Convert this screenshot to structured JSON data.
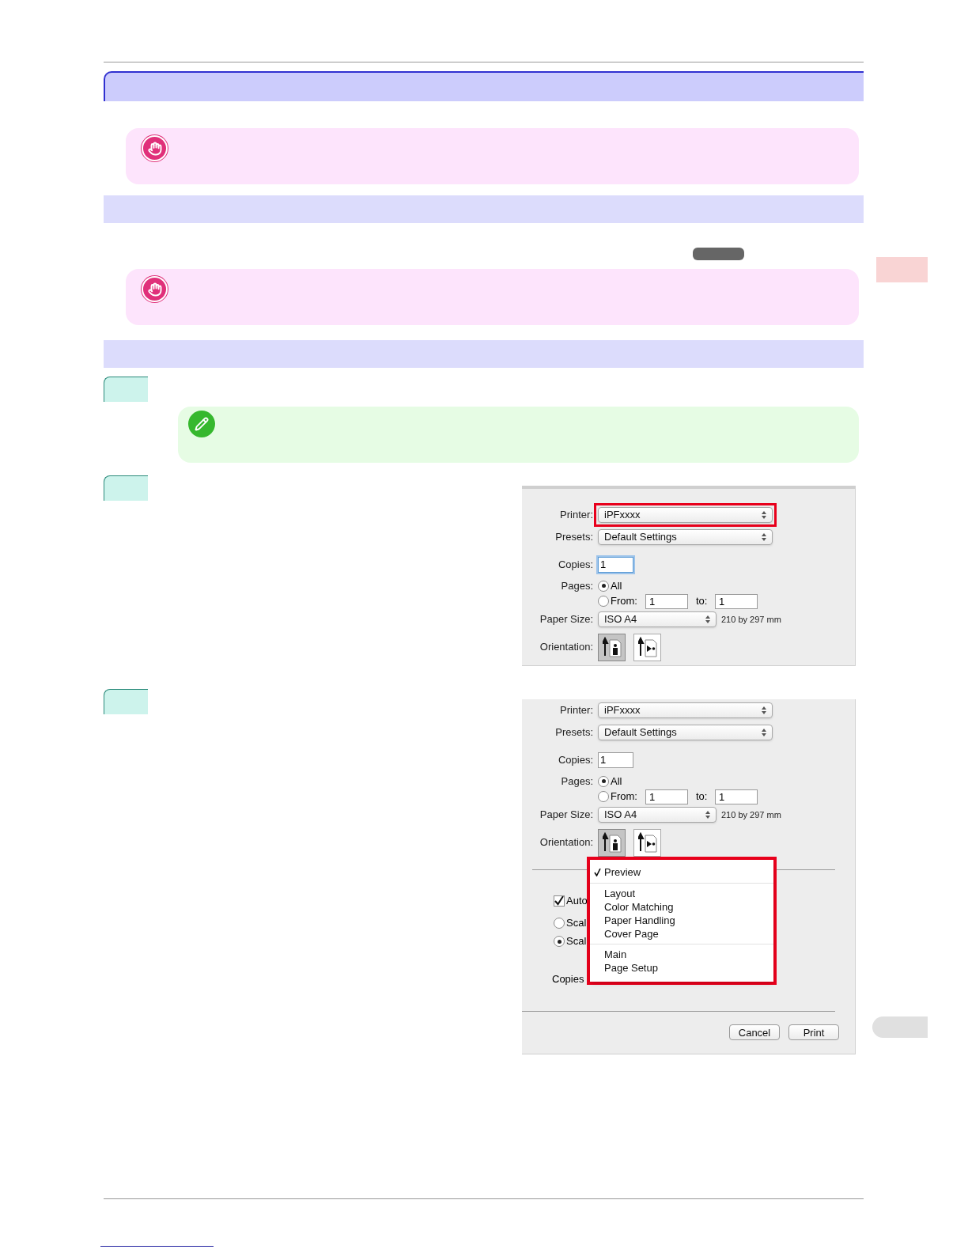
{
  "dialogs": [
    {
      "highlight_printer": true,
      "printer": {
        "label": "Printer:",
        "value": "iPFxxxx"
      },
      "presets": {
        "label": "Presets:",
        "value": "Default Settings"
      },
      "copies": {
        "label": "Copies:",
        "value": "1",
        "focused": true
      },
      "pages": {
        "label": "Pages:",
        "options": [
          {
            "label": "All",
            "selected": true
          },
          {
            "label": "From:",
            "selected": false
          }
        ],
        "from": "1",
        "to_label": "to:",
        "to": "1"
      },
      "paper_size": {
        "label": "Paper Size:",
        "value": "ISO A4",
        "dimensions": "210 by 297 mm"
      },
      "orientation": {
        "label": "Orientation:",
        "options": [
          {
            "kind": "portrait",
            "selected": true
          },
          {
            "kind": "landscape",
            "selected": false
          }
        ]
      }
    },
    {
      "highlight_printer": false,
      "printer": {
        "label": "Printer:",
        "value": "iPFxxxx"
      },
      "presets": {
        "label": "Presets:",
        "value": "Default Settings"
      },
      "copies": {
        "label": "Copies:",
        "value": "1",
        "focused": false
      },
      "pages": {
        "label": "Pages:",
        "options": [
          {
            "label": "All",
            "selected": true
          },
          {
            "label": "From:",
            "selected": false
          }
        ],
        "from": "1",
        "to_label": "to:",
        "to": "1"
      },
      "paper_size": {
        "label": "Paper Size:",
        "value": "ISO A4",
        "dimensions": "210 by 297 mm"
      },
      "orientation": {
        "label": "Orientation:",
        "options": [
          {
            "kind": "portrait",
            "selected": true
          },
          {
            "kind": "landscape",
            "selected": false
          }
        ]
      },
      "options": [
        {
          "kind": "checkbox",
          "label": "Auto",
          "checked": true
        },
        {
          "kind": "radio",
          "label": "Scal",
          "selected": false
        },
        {
          "kind": "radio",
          "label": "Scal",
          "selected": true
        },
        {
          "kind": "label",
          "label": "Copies"
        }
      ],
      "menu": {
        "highlighted": true,
        "sections": [
          [
            {
              "label": "Preview",
              "checked": true
            }
          ],
          [
            {
              "label": "Layout",
              "checked": false
            },
            {
              "label": "Color Matching",
              "checked": false
            },
            {
              "label": "Paper Handling",
              "checked": false
            },
            {
              "label": "Cover Page",
              "checked": false
            }
          ],
          [
            {
              "label": "Main",
              "checked": false
            },
            {
              "label": "Page Setup",
              "checked": false
            }
          ]
        ]
      },
      "buttons": [
        "Cancel",
        "Print"
      ]
    }
  ]
}
